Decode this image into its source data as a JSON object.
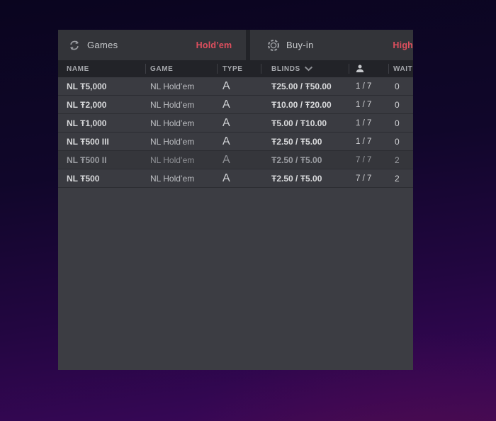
{
  "colors": {
    "accent": "#df4f5e",
    "panel": "#3c3d43",
    "row": "#3a3b41",
    "header_dark": "#222328"
  },
  "tabs": {
    "games": {
      "label": "Games",
      "value": "Hold’em",
      "icon": "cycle-icon"
    },
    "buyin": {
      "label": "Buy-in",
      "value": "High",
      "icon": "chip-icon"
    }
  },
  "table": {
    "columns": {
      "name": "NAME",
      "game": "GAME",
      "type": "TYPE",
      "blinds": "BLINDS",
      "players": "players-icon-column",
      "wait": "WAITLIST"
    },
    "rows": [
      {
        "name": "NL Ŧ5,000",
        "game": "NL Hold’em",
        "type": "A",
        "blinds": "Ŧ25.00 / Ŧ50.00",
        "players": "1 / 7",
        "wait": "0",
        "dimmed": false
      },
      {
        "name": "NL Ŧ2,000",
        "game": "NL Hold’em",
        "type": "A",
        "blinds": "Ŧ10.00 / Ŧ20.00",
        "players": "1 / 7",
        "wait": "0",
        "dimmed": false
      },
      {
        "name": "NL Ŧ1,000",
        "game": "NL Hold’em",
        "type": "A",
        "blinds": "Ŧ5.00 / Ŧ10.00",
        "players": "1 / 7",
        "wait": "0",
        "dimmed": false
      },
      {
        "name": "NL Ŧ500 III",
        "game": "NL Hold’em",
        "type": "A",
        "blinds": "Ŧ2.50 / Ŧ5.00",
        "players": "1 / 7",
        "wait": "0",
        "dimmed": false
      },
      {
        "name": "NL Ŧ500 II",
        "game": "NL Hold’em",
        "type": "A",
        "blinds": "Ŧ2.50 / Ŧ5.00",
        "players": "7 / 7",
        "wait": "2",
        "dimmed": true
      },
      {
        "name": "NL Ŧ500",
        "game": "NL Hold’em",
        "type": "A",
        "blinds": "Ŧ2.50 / Ŧ5.00",
        "players": "7 / 7",
        "wait": "2",
        "dimmed": false
      }
    ]
  }
}
